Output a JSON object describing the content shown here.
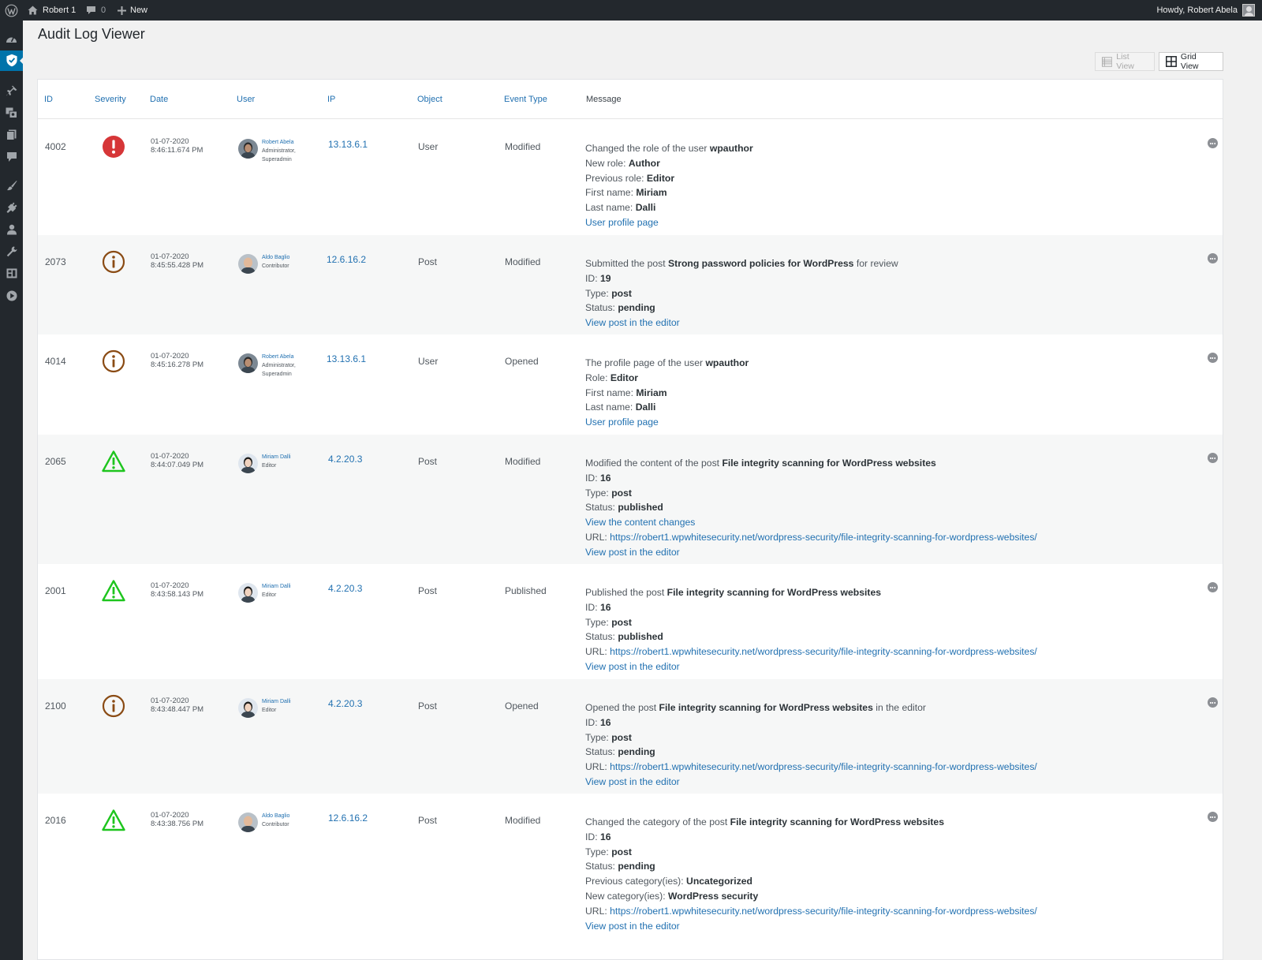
{
  "adminbar": {
    "site_name": "Robert 1",
    "comments_count": "0",
    "new_label": "New",
    "greeting": "Howdy, Robert Abela"
  },
  "page": {
    "title": "Audit Log Viewer"
  },
  "views": {
    "list_label": "List View",
    "grid_label": "Grid View",
    "active": "grid"
  },
  "columns": [
    "ID",
    "Severity",
    "Date",
    "User",
    "IP",
    "Object",
    "Event Type",
    "Message"
  ],
  "severity_colors": {
    "critical": "#d63638",
    "info": "#8a4b14",
    "warning": "#1ec51e"
  },
  "rows": [
    {
      "id": "4002",
      "severity": "critical",
      "date": "01-07-2020",
      "time": "8:46:11.674 PM",
      "user": "Robert Abela",
      "role": "Administrator,",
      "role2": "Superadmin",
      "ip": "13.13.6.1",
      "object": "User",
      "event_type": "Modified",
      "message": [
        {
          "t": "Changed the role of the user ",
          "b": "wpauthor"
        },
        {
          "t": "New role: ",
          "b": "Author"
        },
        {
          "t": "Previous role: ",
          "b": "Editor"
        },
        {
          "t": "First name: ",
          "b": "Miriam"
        },
        {
          "t": "Last name: ",
          "b": "Dalli"
        },
        {
          "link": "User profile page"
        }
      ]
    },
    {
      "id": "2073",
      "severity": "info",
      "date": "01-07-2020",
      "time": "8:45:55.428 PM",
      "user": "Aldo Baglio",
      "role": "Contributor",
      "role2": "",
      "ip": "12.6.16.2",
      "object": "Post",
      "event_type": "Modified",
      "message": [
        {
          "t": "Submitted the post ",
          "b": "Strong password policies for WordPress",
          "t2": " for review"
        },
        {
          "t": "ID: ",
          "b": "19"
        },
        {
          "t": "Type: ",
          "b": "post"
        },
        {
          "t": "Status: ",
          "b": "pending"
        },
        {
          "link": "View post in the editor"
        }
      ]
    },
    {
      "id": "4014",
      "severity": "info",
      "date": "01-07-2020",
      "time": "8:45:16.278 PM",
      "user": "Robert Abela",
      "role": "Administrator,",
      "role2": "Superadmin",
      "ip": "13.13.6.1",
      "object": "User",
      "event_type": "Opened",
      "message": [
        {
          "t": "The profile page of the user ",
          "b": "wpauthor"
        },
        {
          "t": "Role: ",
          "b": "Editor"
        },
        {
          "t": "First name: ",
          "b": "Miriam"
        },
        {
          "t": "Last name: ",
          "b": "Dalli"
        },
        {
          "link": "User profile page"
        }
      ]
    },
    {
      "id": "2065",
      "severity": "warning",
      "date": "01-07-2020",
      "time": "8:44:07.049 PM",
      "user": "Miriam Dalli",
      "role": "Editor",
      "role2": "",
      "ip": "4.2.20.3",
      "object": "Post",
      "event_type": "Modified",
      "message": [
        {
          "t": "Modified the content of the post ",
          "b": "File integrity scanning for WordPress websites"
        },
        {
          "t": "ID: ",
          "b": "16"
        },
        {
          "t": "Type: ",
          "b": "post"
        },
        {
          "t": "Status: ",
          "b": "published"
        },
        {
          "link": "View the content changes"
        },
        {
          "t": "URL: ",
          "url": "https://robert1.wpwhitesecurity.net/wordpress-security/file-integrity-scanning-for-wordpress-websites/"
        },
        {
          "link": "View post in the editor"
        }
      ]
    },
    {
      "id": "2001",
      "severity": "warning",
      "date": "01-07-2020",
      "time": "8:43:58.143 PM",
      "user": "Miriam Dalli",
      "role": "Editor",
      "role2": "",
      "ip": "4.2.20.3",
      "object": "Post",
      "event_type": "Published",
      "message": [
        {
          "t": "Published the post ",
          "b": "File integrity scanning for WordPress websites"
        },
        {
          "t": "ID: ",
          "b": "16"
        },
        {
          "t": "Type: ",
          "b": "post"
        },
        {
          "t": "Status: ",
          "b": "published"
        },
        {
          "t": "URL: ",
          "url": "https://robert1.wpwhitesecurity.net/wordpress-security/file-integrity-scanning-for-wordpress-websites/"
        },
        {
          "link": "View post in the editor"
        }
      ]
    },
    {
      "id": "2100",
      "severity": "info",
      "date": "01-07-2020",
      "time": "8:43:48.447 PM",
      "user": "Miriam Dalli",
      "role": "Editor",
      "role2": "",
      "ip": "4.2.20.3",
      "object": "Post",
      "event_type": "Opened",
      "message": [
        {
          "t": "Opened the post ",
          "b": "File integrity scanning for WordPress websites",
          "t2": " in the editor"
        },
        {
          "t": "ID: ",
          "b": "16"
        },
        {
          "t": "Type: ",
          "b": "post"
        },
        {
          "t": "Status: ",
          "b": "pending"
        },
        {
          "t": "URL: ",
          "url": "https://robert1.wpwhitesecurity.net/wordpress-security/file-integrity-scanning-for-wordpress-websites/"
        },
        {
          "link": "View post in the editor"
        }
      ]
    },
    {
      "id": "2016",
      "severity": "warning",
      "date": "01-07-2020",
      "time": "8:43:38.756 PM",
      "user": "Aldo Baglio",
      "role": "Contributor",
      "role2": "",
      "ip": "12.6.16.2",
      "object": "Post",
      "event_type": "Modified",
      "message": [
        {
          "t": "Changed the category of the post ",
          "b": "File integrity scanning for WordPress websites"
        },
        {
          "t": "ID: ",
          "b": "16"
        },
        {
          "t": "Type: ",
          "b": "post"
        },
        {
          "t": "Status: ",
          "b": "pending"
        },
        {
          "t": "Previous category(ies): ",
          "b": "Uncategorized"
        },
        {
          "t": "New category(ies): ",
          "b": "WordPress security"
        },
        {
          "t": "URL: ",
          "url": "https://robert1.wpwhitesecurity.net/wordpress-security/file-integrity-scanning-for-wordpress-websites/"
        },
        {
          "link": "View post in the editor"
        }
      ]
    }
  ]
}
